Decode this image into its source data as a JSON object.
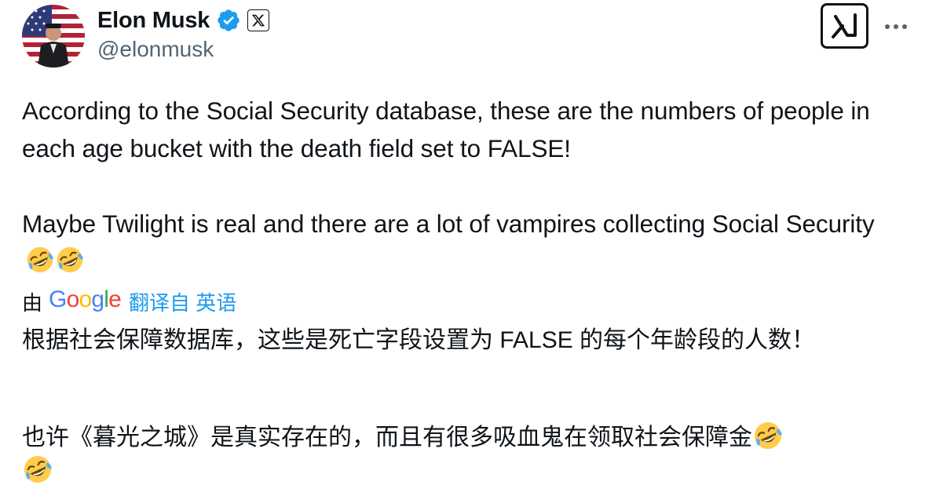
{
  "author": {
    "display_name": "Elon Musk",
    "handle": "@elonmusk"
  },
  "tweet": {
    "paragraph_1": "According to the Social Security database, these are the numbers of people in each age bucket with the death field set to FALSE!",
    "paragraph_2": "Maybe Twilight is real and there are a lot of vampires collecting Social Security"
  },
  "translation": {
    "by": "由",
    "provider": "Google",
    "translated_from": "翻译自 英语",
    "paragraph_1": "根据社会保障数据库，这些是死亡字段设置为 FALSE 的每个年龄段的人数！",
    "paragraph_2": "也许《暮光之城》是真实存在的，而且有很多吸血鬼在领取社会保障金"
  },
  "icons": {
    "verified": "verified-badge-icon",
    "x_affiliation": "x-logo-icon",
    "grok": "grok-icon",
    "more": "more-options-icon",
    "emoji": "rolling-on-floor-laughing-emoji"
  },
  "colors": {
    "text": "#0f1419",
    "secondary": "#536471",
    "link": "#1d9bf0",
    "verified": "#1d9bf0"
  }
}
